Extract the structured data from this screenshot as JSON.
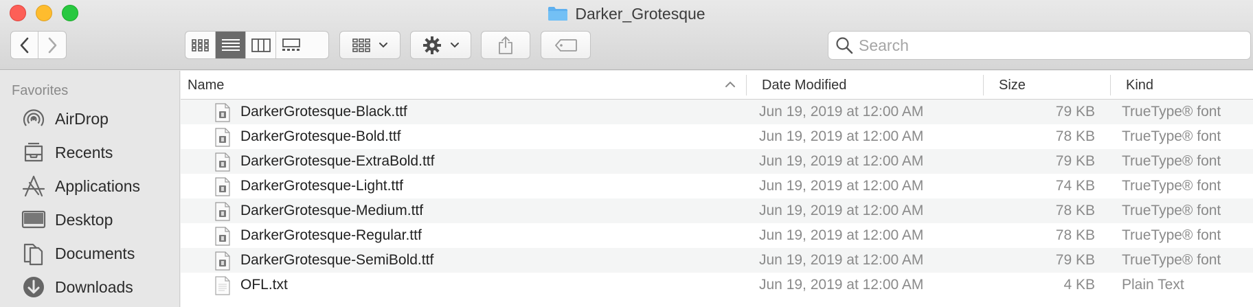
{
  "window": {
    "title": "Darker_Grotesque"
  },
  "toolbar": {
    "back": "back",
    "forward": "forward",
    "views": [
      "icon-view",
      "list-view",
      "column-view",
      "gallery-view"
    ],
    "active_view": "list-view",
    "group": "group-by",
    "action": "action-gear",
    "share": "share",
    "tags": "tags"
  },
  "search": {
    "placeholder": "Search",
    "value": ""
  },
  "sidebar": {
    "section": "Favorites",
    "items": [
      {
        "label": "AirDrop",
        "icon": "airdrop-icon"
      },
      {
        "label": "Recents",
        "icon": "recents-icon"
      },
      {
        "label": "Applications",
        "icon": "applications-icon"
      },
      {
        "label": "Desktop",
        "icon": "desktop-icon"
      },
      {
        "label": "Documents",
        "icon": "documents-icon"
      },
      {
        "label": "Downloads",
        "icon": "downloads-icon"
      }
    ]
  },
  "columns": {
    "name": "Name",
    "date": "Date Modified",
    "size": "Size",
    "kind": "Kind",
    "sort": "Name ascending"
  },
  "files": [
    {
      "name": "DarkerGrotesque-Black.ttf",
      "date": "Jun 19, 2019 at 12:00 AM",
      "size": "79 KB",
      "kind": "TrueType® font",
      "icon": "font-file-icon"
    },
    {
      "name": "DarkerGrotesque-Bold.ttf",
      "date": "Jun 19, 2019 at 12:00 AM",
      "size": "78 KB",
      "kind": "TrueType® font",
      "icon": "font-file-icon"
    },
    {
      "name": "DarkerGrotesque-ExtraBold.ttf",
      "date": "Jun 19, 2019 at 12:00 AM",
      "size": "79 KB",
      "kind": "TrueType® font",
      "icon": "font-file-icon"
    },
    {
      "name": "DarkerGrotesque-Light.ttf",
      "date": "Jun 19, 2019 at 12:00 AM",
      "size": "74 KB",
      "kind": "TrueType® font",
      "icon": "font-file-icon"
    },
    {
      "name": "DarkerGrotesque-Medium.ttf",
      "date": "Jun 19, 2019 at 12:00 AM",
      "size": "78 KB",
      "kind": "TrueType® font",
      "icon": "font-file-icon"
    },
    {
      "name": "DarkerGrotesque-Regular.ttf",
      "date": "Jun 19, 2019 at 12:00 AM",
      "size": "78 KB",
      "kind": "TrueType® font",
      "icon": "font-file-icon"
    },
    {
      "name": "DarkerGrotesque-SemiBold.ttf",
      "date": "Jun 19, 2019 at 12:00 AM",
      "size": "79 KB",
      "kind": "TrueType® font",
      "icon": "font-file-icon"
    },
    {
      "name": "OFL.txt",
      "date": "Jun 19, 2019 at 12:00 AM",
      "size": "4 KB",
      "kind": "Plain Text",
      "icon": "text-file-icon"
    }
  ],
  "colors": {
    "close": "#fd5f57",
    "minimize": "#febc2e",
    "maximize": "#28c840",
    "folder": "#5eb0ef",
    "active_segment": "#6a6a6a"
  }
}
